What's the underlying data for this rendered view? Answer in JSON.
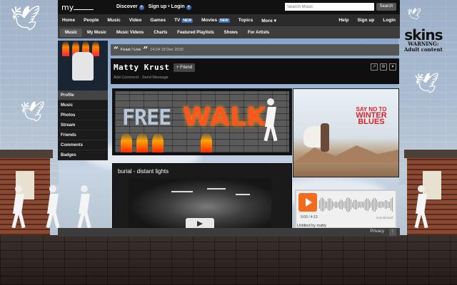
{
  "topbar": {
    "logo": "my",
    "discover": "Discover",
    "signup_login": "Sign up • Login",
    "search_placeholder": "Search Music",
    "search_button": "Search"
  },
  "navbar": {
    "items": [
      "Home",
      "People",
      "Music",
      "Video",
      "Games",
      "TV",
      "Movies",
      "Topics",
      "More ▾"
    ],
    "new_badge": "NEW",
    "right_items": [
      "Help",
      "Sign up",
      "Login"
    ]
  },
  "subnav": {
    "items": [
      "Music",
      "My Music",
      "Music Videos",
      "Charts",
      "Featured Playlists",
      "Shows",
      "For Artists"
    ]
  },
  "sidebar": {
    "items": [
      "Profile",
      "Music",
      "Photos",
      "Stream",
      "Friends",
      "Comments",
      "Badges"
    ]
  },
  "status": {
    "text": "Feast / Live",
    "timestamp": "14:24 18 Dec 2010"
  },
  "profile": {
    "name": "Matty Krust",
    "friend_button": "+ Friend",
    "actions": "Add Comment · Send Message"
  },
  "banner": {
    "word1": "FREE",
    "word2": "WALK"
  },
  "ad": {
    "line1": "SAY NO TO",
    "line2": "WINTER",
    "line3": "BLUES"
  },
  "video": {
    "title": "burial - distant lights"
  },
  "player": {
    "time": "0:00 / 4:13",
    "caption": "Untitled by matty",
    "brand": "soundcloud"
  },
  "footer": {
    "privacy": "Privacy",
    "more": "⋮"
  },
  "skins": {
    "brand": "skins",
    "warning": "WARNING:",
    "adult": "Adult content"
  },
  "colors": {
    "accent_blue": "#3b6db5",
    "orange": "#f26b1f",
    "walk_red": "#ff5520"
  }
}
